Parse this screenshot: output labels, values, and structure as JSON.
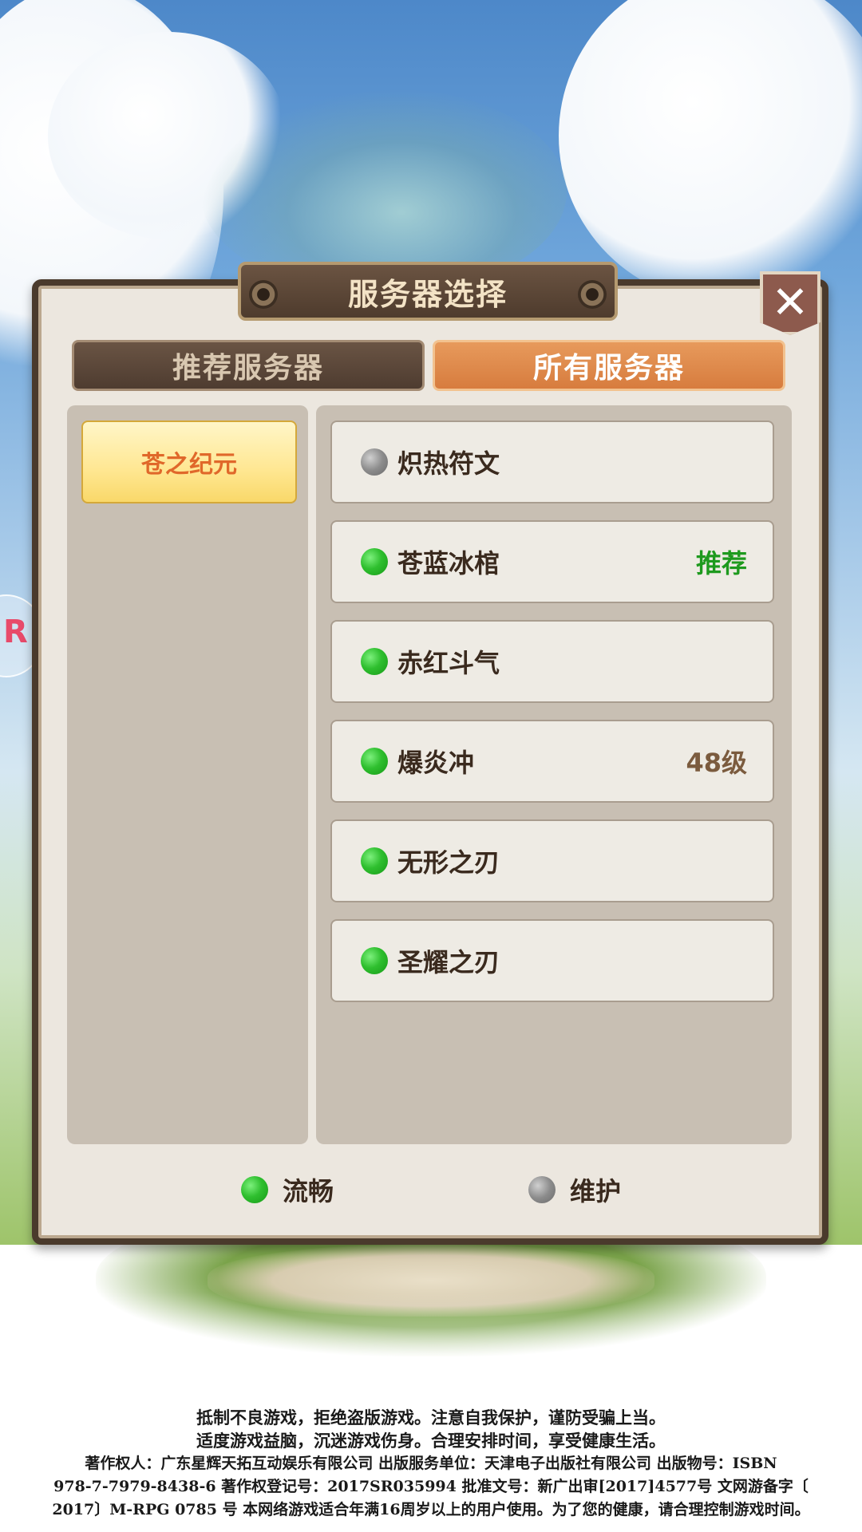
{
  "dialog": {
    "title": "服务器选择",
    "close_label": "✕"
  },
  "tabs": [
    {
      "label": "推荐服务器",
      "active": false
    },
    {
      "label": "所有服务器",
      "active": true
    }
  ],
  "zones": [
    {
      "label": "苍之纪元",
      "selected": true
    }
  ],
  "servers": [
    {
      "name": "炽热符文",
      "status": "maintenance",
      "tag": ""
    },
    {
      "name": "苍蓝冰棺",
      "status": "smooth",
      "tag": "推荐"
    },
    {
      "name": "赤红斗气",
      "status": "smooth",
      "tag": ""
    },
    {
      "name": "爆炎冲",
      "status": "smooth",
      "tag": "48级"
    },
    {
      "name": "无形之刃",
      "status": "smooth",
      "tag": ""
    },
    {
      "name": "圣耀之刃",
      "status": "smooth",
      "tag": ""
    }
  ],
  "legend": {
    "smooth_label": "流畅",
    "maintenance_label": "维护"
  },
  "side_badge": "R",
  "footer": {
    "line1": "抵制不良游戏，拒绝盗版游戏。注意自我保护，谨防受骗上当。",
    "line2": "适度游戏益脑，沉迷游戏伤身。合理安排时间，享受健康生活。",
    "line3": "著作权人：广东星辉天拓互动娱乐有限公司  出版服务单位：天津电子出版社有限公司  出版物号：ISBN",
    "line4": "978-7-7979-8438-6  著作权登记号：2017SR035994  批准文号：新广出审[2017]4577号  文网游备字〔",
    "line5": "2017〕M-RPG 0785 号  本网络游戏适合年满16周岁以上的用户使用。为了您的健康，请合理控制游戏时间。"
  },
  "colors": {
    "status_smooth": "#2fbf2f",
    "status_maintenance": "#8c8c8c",
    "tab_active": "#d77c3e",
    "tab_inactive": "#4e3c30",
    "zone_selected": "#ffe792",
    "tag_recommend": "#1e9a1e"
  }
}
